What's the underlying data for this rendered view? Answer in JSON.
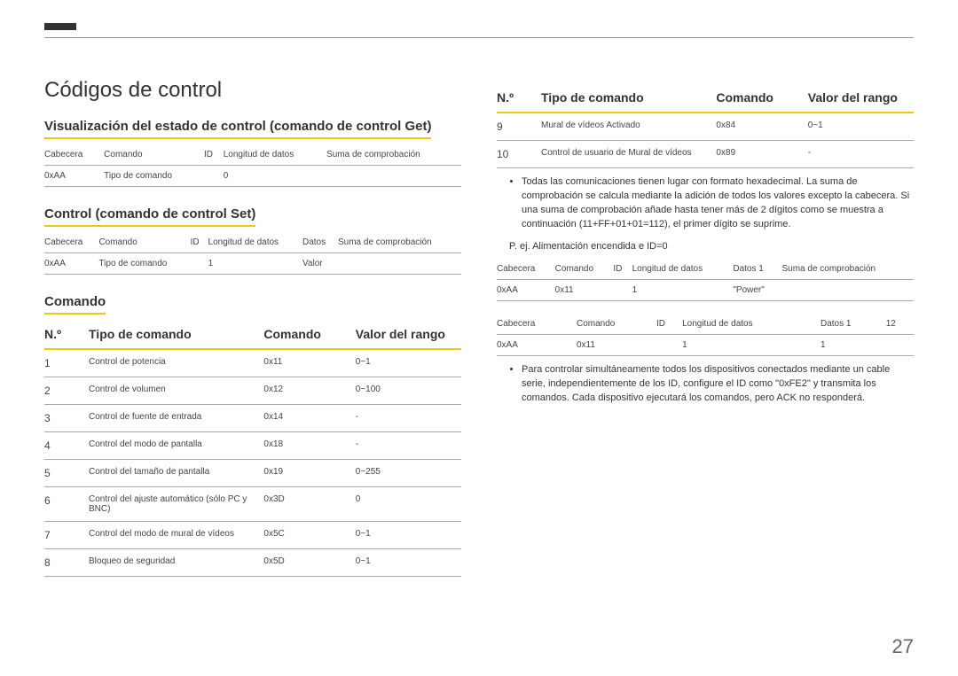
{
  "page_number": "27",
  "left": {
    "h1": "Códigos de control",
    "sec_get": {
      "title": "Visualización del estado de control (comando de control Get)",
      "headers": [
        "Cabecera",
        "Comando",
        "ID",
        "Longitud de datos",
        "Suma de comprobación"
      ],
      "row": [
        "0xAA",
        "Tipo de comando",
        "",
        "0",
        ""
      ]
    },
    "sec_set": {
      "title": "Control (comando de control Set)",
      "headers": [
        "Cabecera",
        "Comando",
        "ID",
        "Longitud de datos",
        "Datos",
        "Suma de comprobación"
      ],
      "row": [
        "0xAA",
        "Tipo de comando",
        "",
        "1",
        "Valor",
        ""
      ]
    },
    "sec_cmd": {
      "title": "Comando",
      "headers": {
        "no": "N.º",
        "tipo": "Tipo de comando",
        "cmd": "Comando",
        "rango": "Valor del rango"
      },
      "rows": [
        {
          "no": "1",
          "tipo": "Control de potencia",
          "cmd": "0x11",
          "rango": "0~1"
        },
        {
          "no": "2",
          "tipo": "Control de volumen",
          "cmd": "0x12",
          "rango": "0~100"
        },
        {
          "no": "3",
          "tipo": "Control de fuente de entrada",
          "cmd": "0x14",
          "rango": "-"
        },
        {
          "no": "4",
          "tipo": "Control del modo de pantalla",
          "cmd": "0x18",
          "rango": "-"
        },
        {
          "no": "5",
          "tipo": "Control del tamaño de pantalla",
          "cmd": "0x19",
          "rango": "0~255"
        },
        {
          "no": "6",
          "tipo": "Control del ajuste automático (sólo PC y BNC)",
          "cmd": "0x3D",
          "rango": "0"
        },
        {
          "no": "7",
          "tipo": "Control del modo de mural de vídeos",
          "cmd": "0x5C",
          "rango": "0~1"
        },
        {
          "no": "8",
          "tipo": "Bloqueo de seguridad",
          "cmd": "0x5D",
          "rango": "0~1"
        }
      ]
    }
  },
  "right": {
    "headers": {
      "no": "N.º",
      "tipo": "Tipo de comando",
      "cmd": "Comando",
      "rango": "Valor del rango"
    },
    "rows": [
      {
        "no": "9",
        "tipo": "Mural de vídeos Activado",
        "cmd": "0x84",
        "rango": "0~1"
      },
      {
        "no": "10",
        "tipo": "Control de usuario de Mural de vídeos",
        "cmd": "0x89",
        "rango": "-"
      }
    ],
    "note1": "Todas las comunicaciones tienen lugar con formato hexadecimal. La suma de comprobación se calcula mediante la adición de todos los valores excepto la cabecera. Si una suma de comprobación añade hasta tener más de 2 dígitos como se muestra a continuación (11+FF+01+01=112), el primer dígito se suprime.",
    "example_label": "P. ej. Alimentación encendida e ID=0",
    "ex1": {
      "headers": [
        "Cabecera",
        "Comando",
        "ID",
        "Longitud de datos",
        "Datos 1",
        "Suma de comprobación"
      ],
      "row": [
        "0xAA",
        "0x11",
        "",
        "1",
        "\"Power\"",
        ""
      ]
    },
    "ex2": {
      "headers": [
        "Cabecera",
        "Comando",
        "ID",
        "Longitud de datos",
        "Datos 1",
        "12"
      ],
      "row": [
        "0xAA",
        "0x11",
        "",
        "1",
        "1",
        ""
      ]
    },
    "note2": "Para controlar simultáneamente todos los dispositivos conectados mediante un cable serie, independientemente de los ID, configure el ID como \"0xFE2\" y transmita los comandos. Cada dispositivo ejecutará los comandos, pero ACK no responderá."
  }
}
